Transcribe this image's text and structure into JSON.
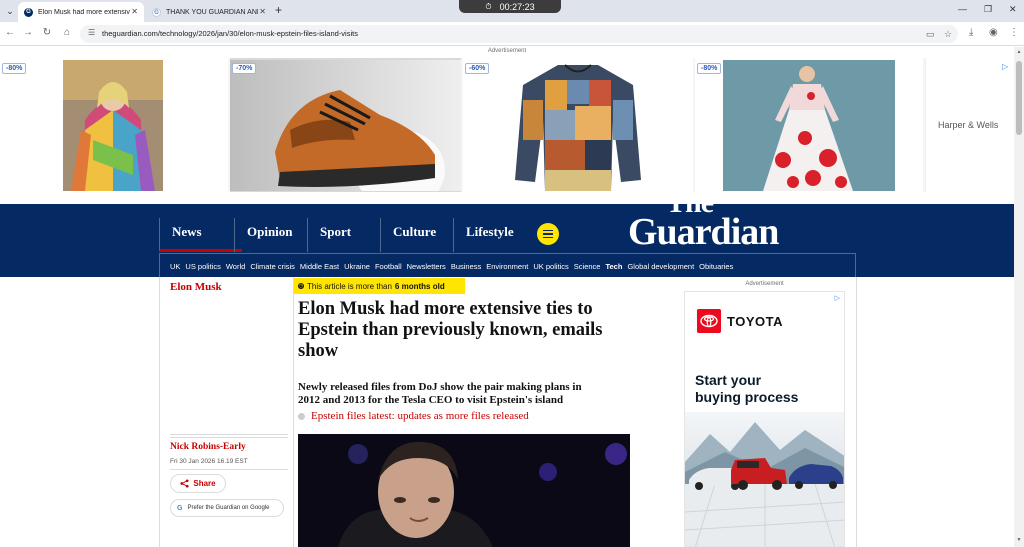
{
  "browser": {
    "tabs": [
      {
        "title": "Elon Musk had more extensive",
        "active": true,
        "favicon": "G"
      },
      {
        "title": "THANK YOU GUARDIAN AND A",
        "active": false,
        "favicon": "G"
      }
    ],
    "timer": "00:27:23",
    "url": "theguardian.com/technology/2026/jan/30/elon-musk-epstein-files-island-visits",
    "icons": [
      "tab-search-icon",
      "back-icon",
      "forward-icon",
      "reload-icon",
      "home-icon",
      "site-info-icon",
      "cast-icon",
      "bookmark-star-icon",
      "download-icon",
      "profile-icon",
      "kebab-menu-icon",
      "minimize-icon",
      "restore-icon",
      "close-icon"
    ]
  },
  "top_ad": {
    "label": "Advertisement",
    "cards": [
      {
        "discount": "-80%",
        "product": "rainbow patchwork hoodie"
      },
      {
        "discount": "-70%",
        "product": "leather sneaker"
      },
      {
        "discount": "-60%",
        "product": "patchwork henley shirt"
      },
      {
        "discount": "-80%",
        "product": "floral maxi dress"
      }
    ],
    "advertiser": "Harper & Wells"
  },
  "header": {
    "pillars": [
      "News",
      "Opinion",
      "Sport",
      "Culture",
      "Lifestyle"
    ],
    "active_pillar": "News",
    "logo_line1": "The",
    "logo_line2": "Guardian",
    "subnav": [
      "UK",
      "US politics",
      "World",
      "Climate crisis",
      "Middle East",
      "Ukraine",
      "Football",
      "Newsletters",
      "Business",
      "Environment",
      "UK politics",
      "Science",
      "Tech",
      "Global development",
      "Obituaries"
    ],
    "current_section": "Tech",
    "brand_blue": "#052962",
    "accent_red": "#c70000",
    "highlight_yellow": "#ffe500"
  },
  "article": {
    "series": "Elon Musk",
    "age_prefix": "This article is more than",
    "age_value": "6 months old",
    "headline": "Elon Musk had more extensive ties to Epstein than previously known, emails show",
    "standfirst": "Newly released files from DoJ show the pair making plans in 2012 and 2013 for the Tesla CEO to visit Epstein's island",
    "live_link": "Epstein files latest: updates as more files released",
    "author": "Nick Robins-Early",
    "date": "Fri 30 Jan 2026 16.19 EST",
    "share_label": "Share",
    "prefer_label": "Prefer the Guardian on Google"
  },
  "right_ad": {
    "label": "Advertisement",
    "brand": "TOYOTA",
    "headline_line1": "Start your",
    "headline_line2": "buying process"
  }
}
